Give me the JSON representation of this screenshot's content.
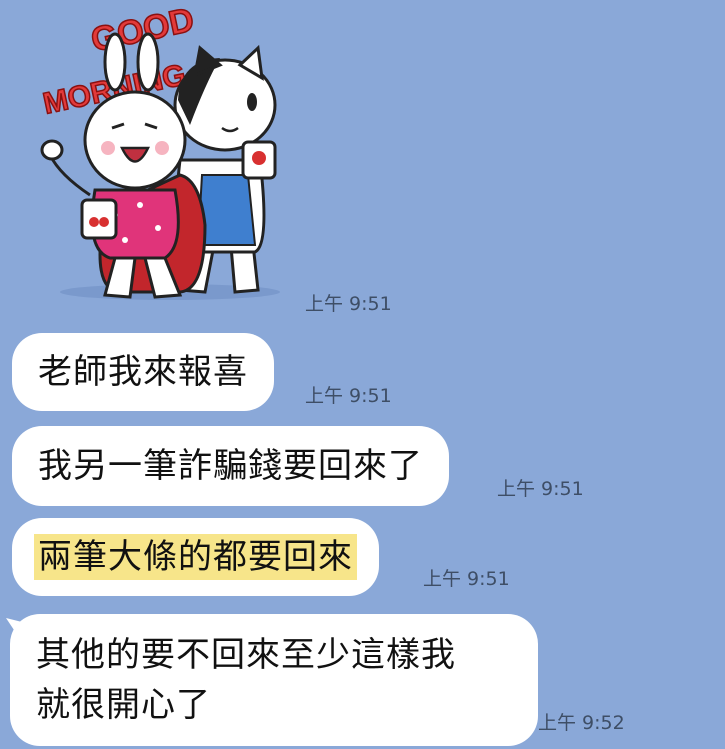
{
  "sticker": {
    "text_line1": "GOOD",
    "text_line2": "MORNING",
    "icon": "good-morning-bunny-cat-sticker",
    "time": "上午 9:51"
  },
  "messages": [
    {
      "text": "老師我來報喜",
      "time": "上午 9:51"
    },
    {
      "text": "我另一筆詐騙錢要回來了",
      "time": "上午 9:51"
    },
    {
      "text": "兩筆大條的都要回來",
      "time": "上午 9:51",
      "highlighted": true
    },
    {
      "lines": [
        "其他的要不回來至少這樣我",
        "就很開心了"
      ],
      "time": "上午 9:52"
    }
  ],
  "colors": {
    "chat_background": "#8aa8d8",
    "bubble": "#ffffff",
    "highlight": "#f7e58a",
    "timestamp": "#3e4e66"
  }
}
